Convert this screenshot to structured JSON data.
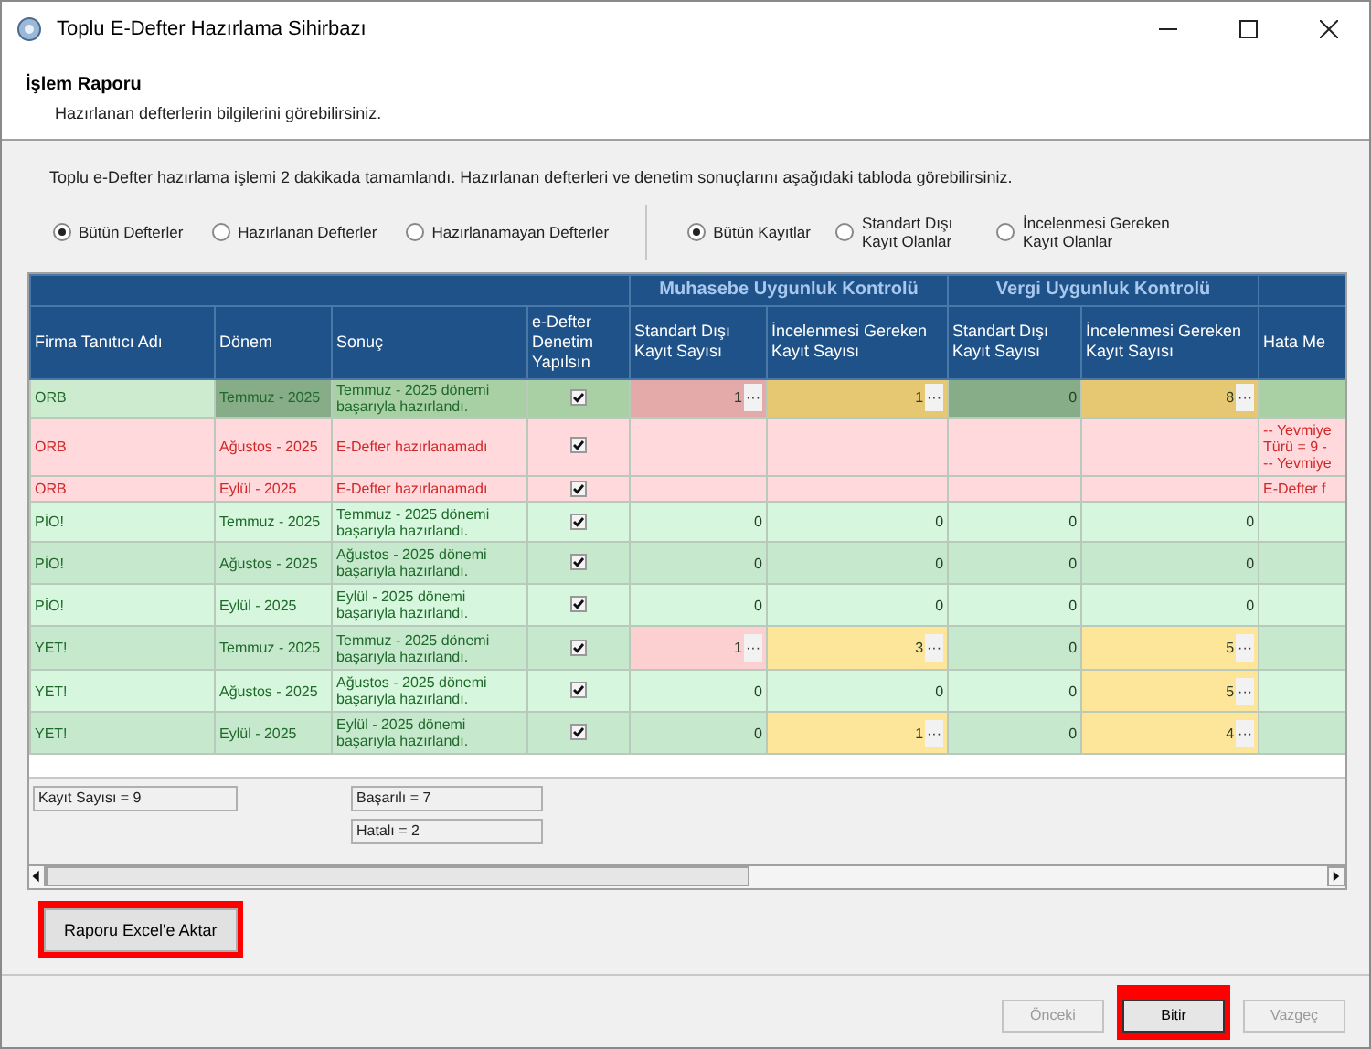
{
  "window": {
    "title": "Toplu E-Defter Hazırlama Sihirbazı"
  },
  "header": {
    "title": "İşlem Raporu",
    "subtitle": "Hazırlanan defterlerin bilgilerini görebilirsiniz."
  },
  "info": "Toplu e-Defter hazırlama işlemi 2 dakikada tamamlandı. Hazırlanan defterleri ve denetim sonuçlarını aşağıdaki tabloda görebilirsiniz.",
  "book_filter": [
    {
      "label": "Bütün Defterler",
      "selected": true
    },
    {
      "label": "Hazırlanan Defterler",
      "selected": false
    },
    {
      "label": "Hazırlanamayan Defterler",
      "selected": false
    }
  ],
  "record_filter": [
    {
      "label": "Bütün Kayıtlar",
      "selected": true
    },
    {
      "label": "Standart Dışı Kayıt Olanlar",
      "selected": false
    },
    {
      "label": "İncelenmesi Gereken Kayıt Olanlar",
      "selected": false
    }
  ],
  "table": {
    "groups": [
      "Muhasebe Uygunluk Kontrolü",
      "Vergi Uygunluk Kontrolü"
    ],
    "columns": [
      "Firma Tanıtıcı Adı",
      "Dönem",
      "Sonuç",
      "e-Defter Denetim Yapılsın",
      "Standart Dışı Kayıt Sayısı",
      "İncelenmesi Gereken Kayıt Sayısı",
      "Standart Dışı Kayıt Sayısı",
      "İncelenmesi Gereken Kayıt Sayısı",
      "Hata Me"
    ],
    "rows": [
      {
        "kind": "success",
        "selected": true,
        "firm": "ORB",
        "period": "Temmuz - 2025",
        "result": "Temmuz - 2025 dönemi başarıyla hazırlandı.",
        "audit": true,
        "counts": [
          {
            "text": "1",
            "flagged": true,
            "button": "···"
          },
          {
            "text": "1",
            "flagged": true,
            "button": "···"
          },
          {
            "text": "0",
            "flagged": false
          },
          {
            "text": "8",
            "flagged": true,
            "button": "···"
          }
        ]
      },
      {
        "kind": "error",
        "selected": false,
        "firm": "ORB",
        "period": "Ağustos - 2025",
        "result": "E-Defter hazırlanamadı",
        "audit": true,
        "error_lines": [
          "-- Yevmiye",
          "Türü = 9 -",
          "-- Yevmiye"
        ]
      },
      {
        "kind": "error",
        "selected": false,
        "firm": "ORB",
        "period": "Eylül - 2025",
        "result": "E-Defter hazırlanamadı",
        "audit": true,
        "error_lines": [
          "E-Defter f"
        ]
      },
      {
        "kind": "success",
        "selected": false,
        "firm": "PİO!",
        "period": "Temmuz - 2025",
        "result": "Temmuz - 2025 dönemi başarıyla hazırlandı.",
        "audit": true,
        "counts": [
          {
            "text": "0",
            "flagged": false
          },
          {
            "text": "0",
            "flagged": false
          },
          {
            "text": "0",
            "flagged": false
          },
          {
            "text": "0",
            "flagged": false
          }
        ]
      },
      {
        "kind": "success",
        "selected": false,
        "firm": "PİO!",
        "period": "Ağustos - 2025",
        "result": "Ağustos - 2025 dönemi başarıyla hazırlandı.",
        "audit": true,
        "counts": [
          {
            "text": "0",
            "flagged": false
          },
          {
            "text": "0",
            "flagged": false
          },
          {
            "text": "0",
            "flagged": false
          },
          {
            "text": "0",
            "flagged": false
          }
        ]
      },
      {
        "kind": "success",
        "selected": false,
        "firm": "PİO!",
        "period": "Eylül - 2025",
        "result": "Eylül - 2025 dönemi başarıyla hazırlandı.",
        "audit": true,
        "counts": [
          {
            "text": "0",
            "flagged": false
          },
          {
            "text": "0",
            "flagged": false
          },
          {
            "text": "0",
            "flagged": false
          },
          {
            "text": "0",
            "flagged": false
          }
        ]
      },
      {
        "kind": "success",
        "selected": false,
        "firm": "YET!",
        "period": "Temmuz - 2025",
        "result": "Temmuz - 2025 dönemi başarıyla hazırlandı.",
        "audit": true,
        "counts": [
          {
            "text": "1",
            "flagged": true,
            "button": "···"
          },
          {
            "text": "3",
            "flagged": true,
            "button": "···"
          },
          {
            "text": "0",
            "flagged": false
          },
          {
            "text": "5",
            "flagged": true,
            "button": "···"
          }
        ]
      },
      {
        "kind": "success",
        "selected": false,
        "firm": "YET!",
        "period": "Ağustos - 2025",
        "result": "Ağustos - 2025 dönemi başarıyla hazırlandı.",
        "audit": true,
        "counts": [
          {
            "text": "0",
            "flagged": false
          },
          {
            "text": "0",
            "flagged": false
          },
          {
            "text": "0",
            "flagged": false
          },
          {
            "text": "5",
            "flagged": true,
            "button": "···"
          }
        ]
      },
      {
        "kind": "success",
        "selected": false,
        "firm": "YET!",
        "period": "Eylül - 2025",
        "result": "Eylül - 2025 dönemi başarıyla hazırlandı.",
        "audit": true,
        "counts": [
          {
            "text": "0",
            "flagged": false
          },
          {
            "text": "1",
            "flagged": true,
            "button": "···"
          },
          {
            "text": "0",
            "flagged": false
          },
          {
            "text": "4",
            "flagged": true,
            "button": "···"
          }
        ]
      }
    ]
  },
  "summary": {
    "total": "Kayıt Sayısı = 9",
    "success": "Başarılı = 7",
    "failed": "Hatalı = 2"
  },
  "export_button": {
    "label": "Raporu Excel'e Aktar",
    "highlighted": true
  },
  "buttons": [
    {
      "label": "Önceki",
      "disabled": true,
      "highlighted": false
    },
    {
      "label": "Bitir",
      "disabled": false,
      "highlighted": true
    },
    {
      "label": "Vazgeç",
      "disabled": true,
      "highlighted": false
    }
  ]
}
